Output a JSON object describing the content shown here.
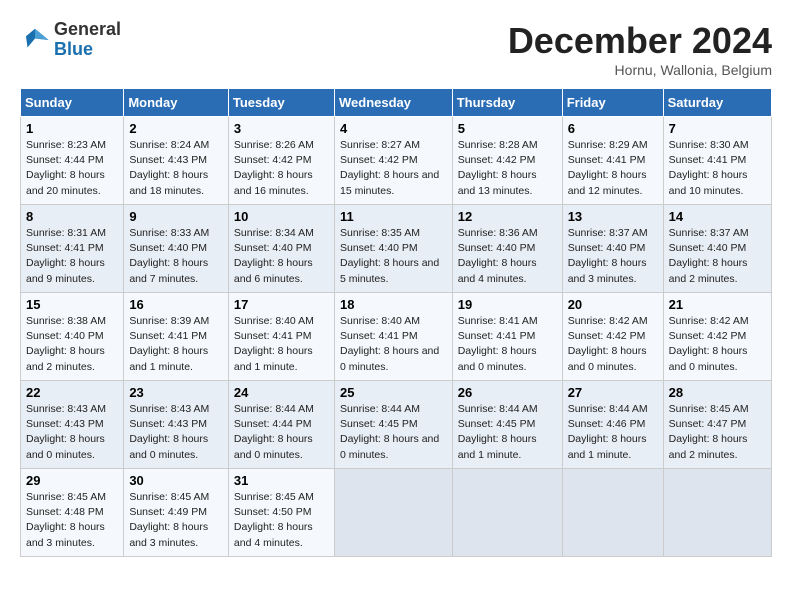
{
  "header": {
    "logo_line1": "General",
    "logo_line2": "Blue",
    "month": "December 2024",
    "location": "Hornu, Wallonia, Belgium"
  },
  "weekdays": [
    "Sunday",
    "Monday",
    "Tuesday",
    "Wednesday",
    "Thursday",
    "Friday",
    "Saturday"
  ],
  "weeks": [
    [
      {
        "day": "1",
        "info": "Sunrise: 8:23 AM\nSunset: 4:44 PM\nDaylight: 8 hours and 20 minutes."
      },
      {
        "day": "2",
        "info": "Sunrise: 8:24 AM\nSunset: 4:43 PM\nDaylight: 8 hours and 18 minutes."
      },
      {
        "day": "3",
        "info": "Sunrise: 8:26 AM\nSunset: 4:42 PM\nDaylight: 8 hours and 16 minutes."
      },
      {
        "day": "4",
        "info": "Sunrise: 8:27 AM\nSunset: 4:42 PM\nDaylight: 8 hours and 15 minutes."
      },
      {
        "day": "5",
        "info": "Sunrise: 8:28 AM\nSunset: 4:42 PM\nDaylight: 8 hours and 13 minutes."
      },
      {
        "day": "6",
        "info": "Sunrise: 8:29 AM\nSunset: 4:41 PM\nDaylight: 8 hours and 12 minutes."
      },
      {
        "day": "7",
        "info": "Sunrise: 8:30 AM\nSunset: 4:41 PM\nDaylight: 8 hours and 10 minutes."
      }
    ],
    [
      {
        "day": "8",
        "info": "Sunrise: 8:31 AM\nSunset: 4:41 PM\nDaylight: 8 hours and 9 minutes."
      },
      {
        "day": "9",
        "info": "Sunrise: 8:33 AM\nSunset: 4:40 PM\nDaylight: 8 hours and 7 minutes."
      },
      {
        "day": "10",
        "info": "Sunrise: 8:34 AM\nSunset: 4:40 PM\nDaylight: 8 hours and 6 minutes."
      },
      {
        "day": "11",
        "info": "Sunrise: 8:35 AM\nSunset: 4:40 PM\nDaylight: 8 hours and 5 minutes."
      },
      {
        "day": "12",
        "info": "Sunrise: 8:36 AM\nSunset: 4:40 PM\nDaylight: 8 hours and 4 minutes."
      },
      {
        "day": "13",
        "info": "Sunrise: 8:37 AM\nSunset: 4:40 PM\nDaylight: 8 hours and 3 minutes."
      },
      {
        "day": "14",
        "info": "Sunrise: 8:37 AM\nSunset: 4:40 PM\nDaylight: 8 hours and 2 minutes."
      }
    ],
    [
      {
        "day": "15",
        "info": "Sunrise: 8:38 AM\nSunset: 4:40 PM\nDaylight: 8 hours and 2 minutes."
      },
      {
        "day": "16",
        "info": "Sunrise: 8:39 AM\nSunset: 4:41 PM\nDaylight: 8 hours and 1 minute."
      },
      {
        "day": "17",
        "info": "Sunrise: 8:40 AM\nSunset: 4:41 PM\nDaylight: 8 hours and 1 minute."
      },
      {
        "day": "18",
        "info": "Sunrise: 8:40 AM\nSunset: 4:41 PM\nDaylight: 8 hours and 0 minutes."
      },
      {
        "day": "19",
        "info": "Sunrise: 8:41 AM\nSunset: 4:41 PM\nDaylight: 8 hours and 0 minutes."
      },
      {
        "day": "20",
        "info": "Sunrise: 8:42 AM\nSunset: 4:42 PM\nDaylight: 8 hours and 0 minutes."
      },
      {
        "day": "21",
        "info": "Sunrise: 8:42 AM\nSunset: 4:42 PM\nDaylight: 8 hours and 0 minutes."
      }
    ],
    [
      {
        "day": "22",
        "info": "Sunrise: 8:43 AM\nSunset: 4:43 PM\nDaylight: 8 hours and 0 minutes."
      },
      {
        "day": "23",
        "info": "Sunrise: 8:43 AM\nSunset: 4:43 PM\nDaylight: 8 hours and 0 minutes."
      },
      {
        "day": "24",
        "info": "Sunrise: 8:44 AM\nSunset: 4:44 PM\nDaylight: 8 hours and 0 minutes."
      },
      {
        "day": "25",
        "info": "Sunrise: 8:44 AM\nSunset: 4:45 PM\nDaylight: 8 hours and 0 minutes."
      },
      {
        "day": "26",
        "info": "Sunrise: 8:44 AM\nSunset: 4:45 PM\nDaylight: 8 hours and 1 minute."
      },
      {
        "day": "27",
        "info": "Sunrise: 8:44 AM\nSunset: 4:46 PM\nDaylight: 8 hours and 1 minute."
      },
      {
        "day": "28",
        "info": "Sunrise: 8:45 AM\nSunset: 4:47 PM\nDaylight: 8 hours and 2 minutes."
      }
    ],
    [
      {
        "day": "29",
        "info": "Sunrise: 8:45 AM\nSunset: 4:48 PM\nDaylight: 8 hours and 3 minutes."
      },
      {
        "day": "30",
        "info": "Sunrise: 8:45 AM\nSunset: 4:49 PM\nDaylight: 8 hours and 3 minutes."
      },
      {
        "day": "31",
        "info": "Sunrise: 8:45 AM\nSunset: 4:50 PM\nDaylight: 8 hours and 4 minutes."
      },
      null,
      null,
      null,
      null
    ]
  ]
}
